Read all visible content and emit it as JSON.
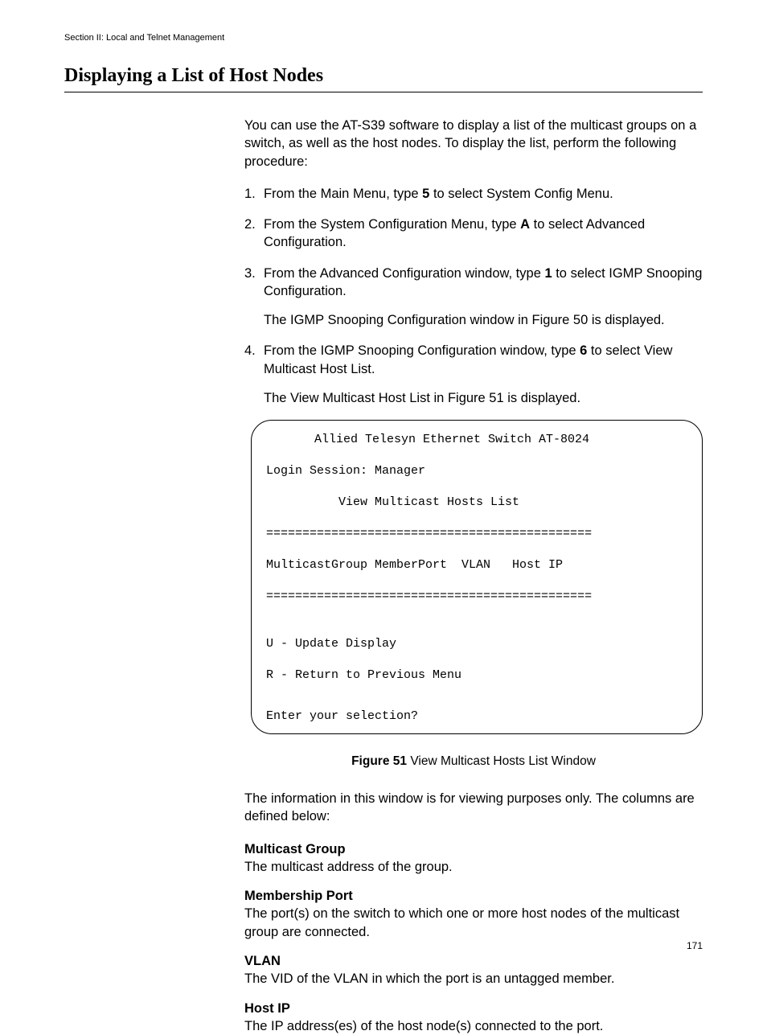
{
  "header": "Section II: Local and Telnet Management",
  "title": "Displaying a List of Host Nodes",
  "intro": "You can use the AT-S39 software to display a list of the multicast groups on a switch, as well as the host nodes. To display the list, perform the following procedure:",
  "steps": [
    {
      "num": "1.",
      "pre": "From the Main Menu, type ",
      "bold": "5",
      "post": " to select System Config Menu."
    },
    {
      "num": "2.",
      "pre": "From the System Configuration Menu, type ",
      "bold": "A",
      "post": " to select Advanced Configuration."
    },
    {
      "num": "3.",
      "pre": "From the Advanced Configuration window, type ",
      "bold": "1",
      "post": " to select IGMP Snooping Configuration.",
      "sub": "The IGMP Snooping Configuration window in Figure 50 is displayed."
    },
    {
      "num": "4.",
      "pre": "From the IGMP Snooping Configuration window, type ",
      "bold": "6",
      "post": " to select View Multicast Host List.",
      "sub": "The View Multicast Host List in Figure 51 is displayed."
    }
  ],
  "terminal": {
    "line1": "Allied Telesyn Ethernet Switch AT-8024",
    "login": "Login Session: Manager",
    "view_title": "View Multicast Hosts List",
    "rule": "=============================================",
    "cols": "MulticastGroup MemberPort  VLAN   Host IP",
    "opt_u": "U - Update Display",
    "opt_r": "R - Return to Previous Menu",
    "prompt": "Enter your selection?"
  },
  "figure": {
    "label": "Figure 51",
    "caption": "  View Multicast Hosts List Window"
  },
  "view_para": "The information in this window is for viewing purposes only. The columns are defined below:",
  "defs": [
    {
      "term": "Multicast Group",
      "desc": "The multicast address of the group."
    },
    {
      "term": "Membership Port",
      "desc": "The port(s) on the switch to which one or more host nodes of the multicast group are connected."
    },
    {
      "term": "VLAN",
      "desc": "The VID of the VLAN in which the port is an untagged member."
    },
    {
      "term": "Host IP",
      "desc": "The IP address(es) of the host node(s) connected to the port."
    }
  ],
  "pageNumber": "171"
}
